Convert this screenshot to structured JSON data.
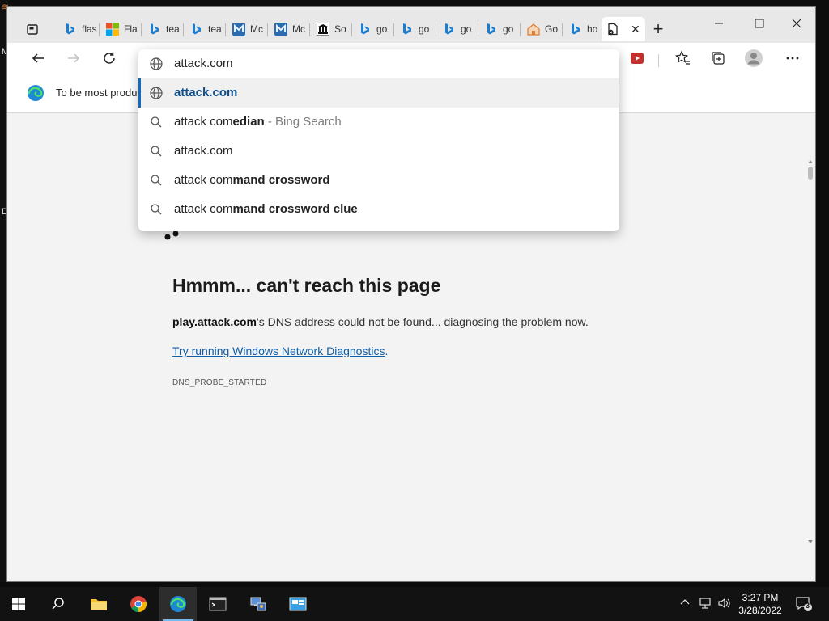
{
  "tabs": [
    {
      "label": "flas",
      "icon": "bing-icon"
    },
    {
      "label": "Fla",
      "icon": "microsoft-icon"
    },
    {
      "label": "tea",
      "icon": "bing-icon"
    },
    {
      "label": "tea",
      "icon": "bing-icon"
    },
    {
      "label": "Mc",
      "icon": "m-logo-icon"
    },
    {
      "label": "Mc",
      "icon": "m-logo-icon"
    },
    {
      "label": "So",
      "icon": "museum-icon"
    },
    {
      "label": "go",
      "icon": "bing-icon"
    },
    {
      "label": "go",
      "icon": "bing-icon"
    },
    {
      "label": "go",
      "icon": "bing-icon"
    },
    {
      "label": "go",
      "icon": "bing-icon"
    },
    {
      "label": "Go",
      "icon": "home-icon"
    },
    {
      "label": "ho",
      "icon": "bing-icon"
    }
  ],
  "address_bar": {
    "value": "attack.com"
  },
  "suggestions": [
    {
      "icon": "globe-icon",
      "typed": "",
      "bold": "attack.com",
      "suffix": ""
    },
    {
      "icon": "search-icon",
      "typed": "attack com",
      "bold": "edian",
      "suffix": " - Bing Search"
    },
    {
      "icon": "search-icon",
      "typed": "attack.com",
      "bold": "",
      "suffix": ""
    },
    {
      "icon": "search-icon",
      "typed": "attack com",
      "bold": "mand crossword",
      "suffix": ""
    },
    {
      "icon": "search-icon",
      "typed": "attack com",
      "bold": "mand crossword clue",
      "suffix": ""
    }
  ],
  "infobar": {
    "text": "To be most productive"
  },
  "error_page": {
    "title": "Hmmm... can't reach this page",
    "host": "play.attack.com",
    "message_rest": "'s DNS address could not be found... diagnosing the problem now.",
    "link": "Try running Windows Network Diagnostics",
    "link_tail": ".",
    "code": "DNS_PROBE_STARTED"
  },
  "taskbar": {
    "time": "3:27 PM",
    "date": "3/28/2022",
    "notifications": "3"
  },
  "colors": {
    "accent": "#0f6cbd",
    "link": "#0f5ea6"
  }
}
